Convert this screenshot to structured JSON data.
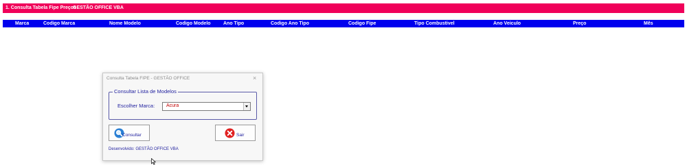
{
  "title_bar": {
    "section": "1. Consulta Tabela Fipe Preços",
    "brand": "GESTÃO OFFICE VBA"
  },
  "table_header": [
    "Marca",
    "Codigo Marca",
    "Nome Modelo",
    "Codigo Modelo",
    "Ano Tipo",
    "Codigo Ano Tipo",
    "Codigo Fipe",
    "Tipo Combustivel",
    "Ano Veiculo",
    "Preço",
    "Mês"
  ],
  "dialog": {
    "title": "Consulta Tabela FIPE - GESTÃO OFFICE",
    "close_glyph": "×",
    "group_title": "Consultar Lista de Modelos",
    "marca_label": "Escolher Marca:",
    "marca_value": "Acura",
    "consultar_label": "Consultar",
    "sair_label": "Sair",
    "developer": "Desenvolvido: GESTÃO OFFICE VBA"
  },
  "icons": {
    "consultar": "magnifier-icon",
    "sair": "close-circle-icon",
    "dropdown": "chevron-down-icon"
  },
  "colors": {
    "title_bar": "#f0005a",
    "header_row": "#0000ee",
    "label_text": "#1f1f9e",
    "combo_value": "#c00000"
  }
}
